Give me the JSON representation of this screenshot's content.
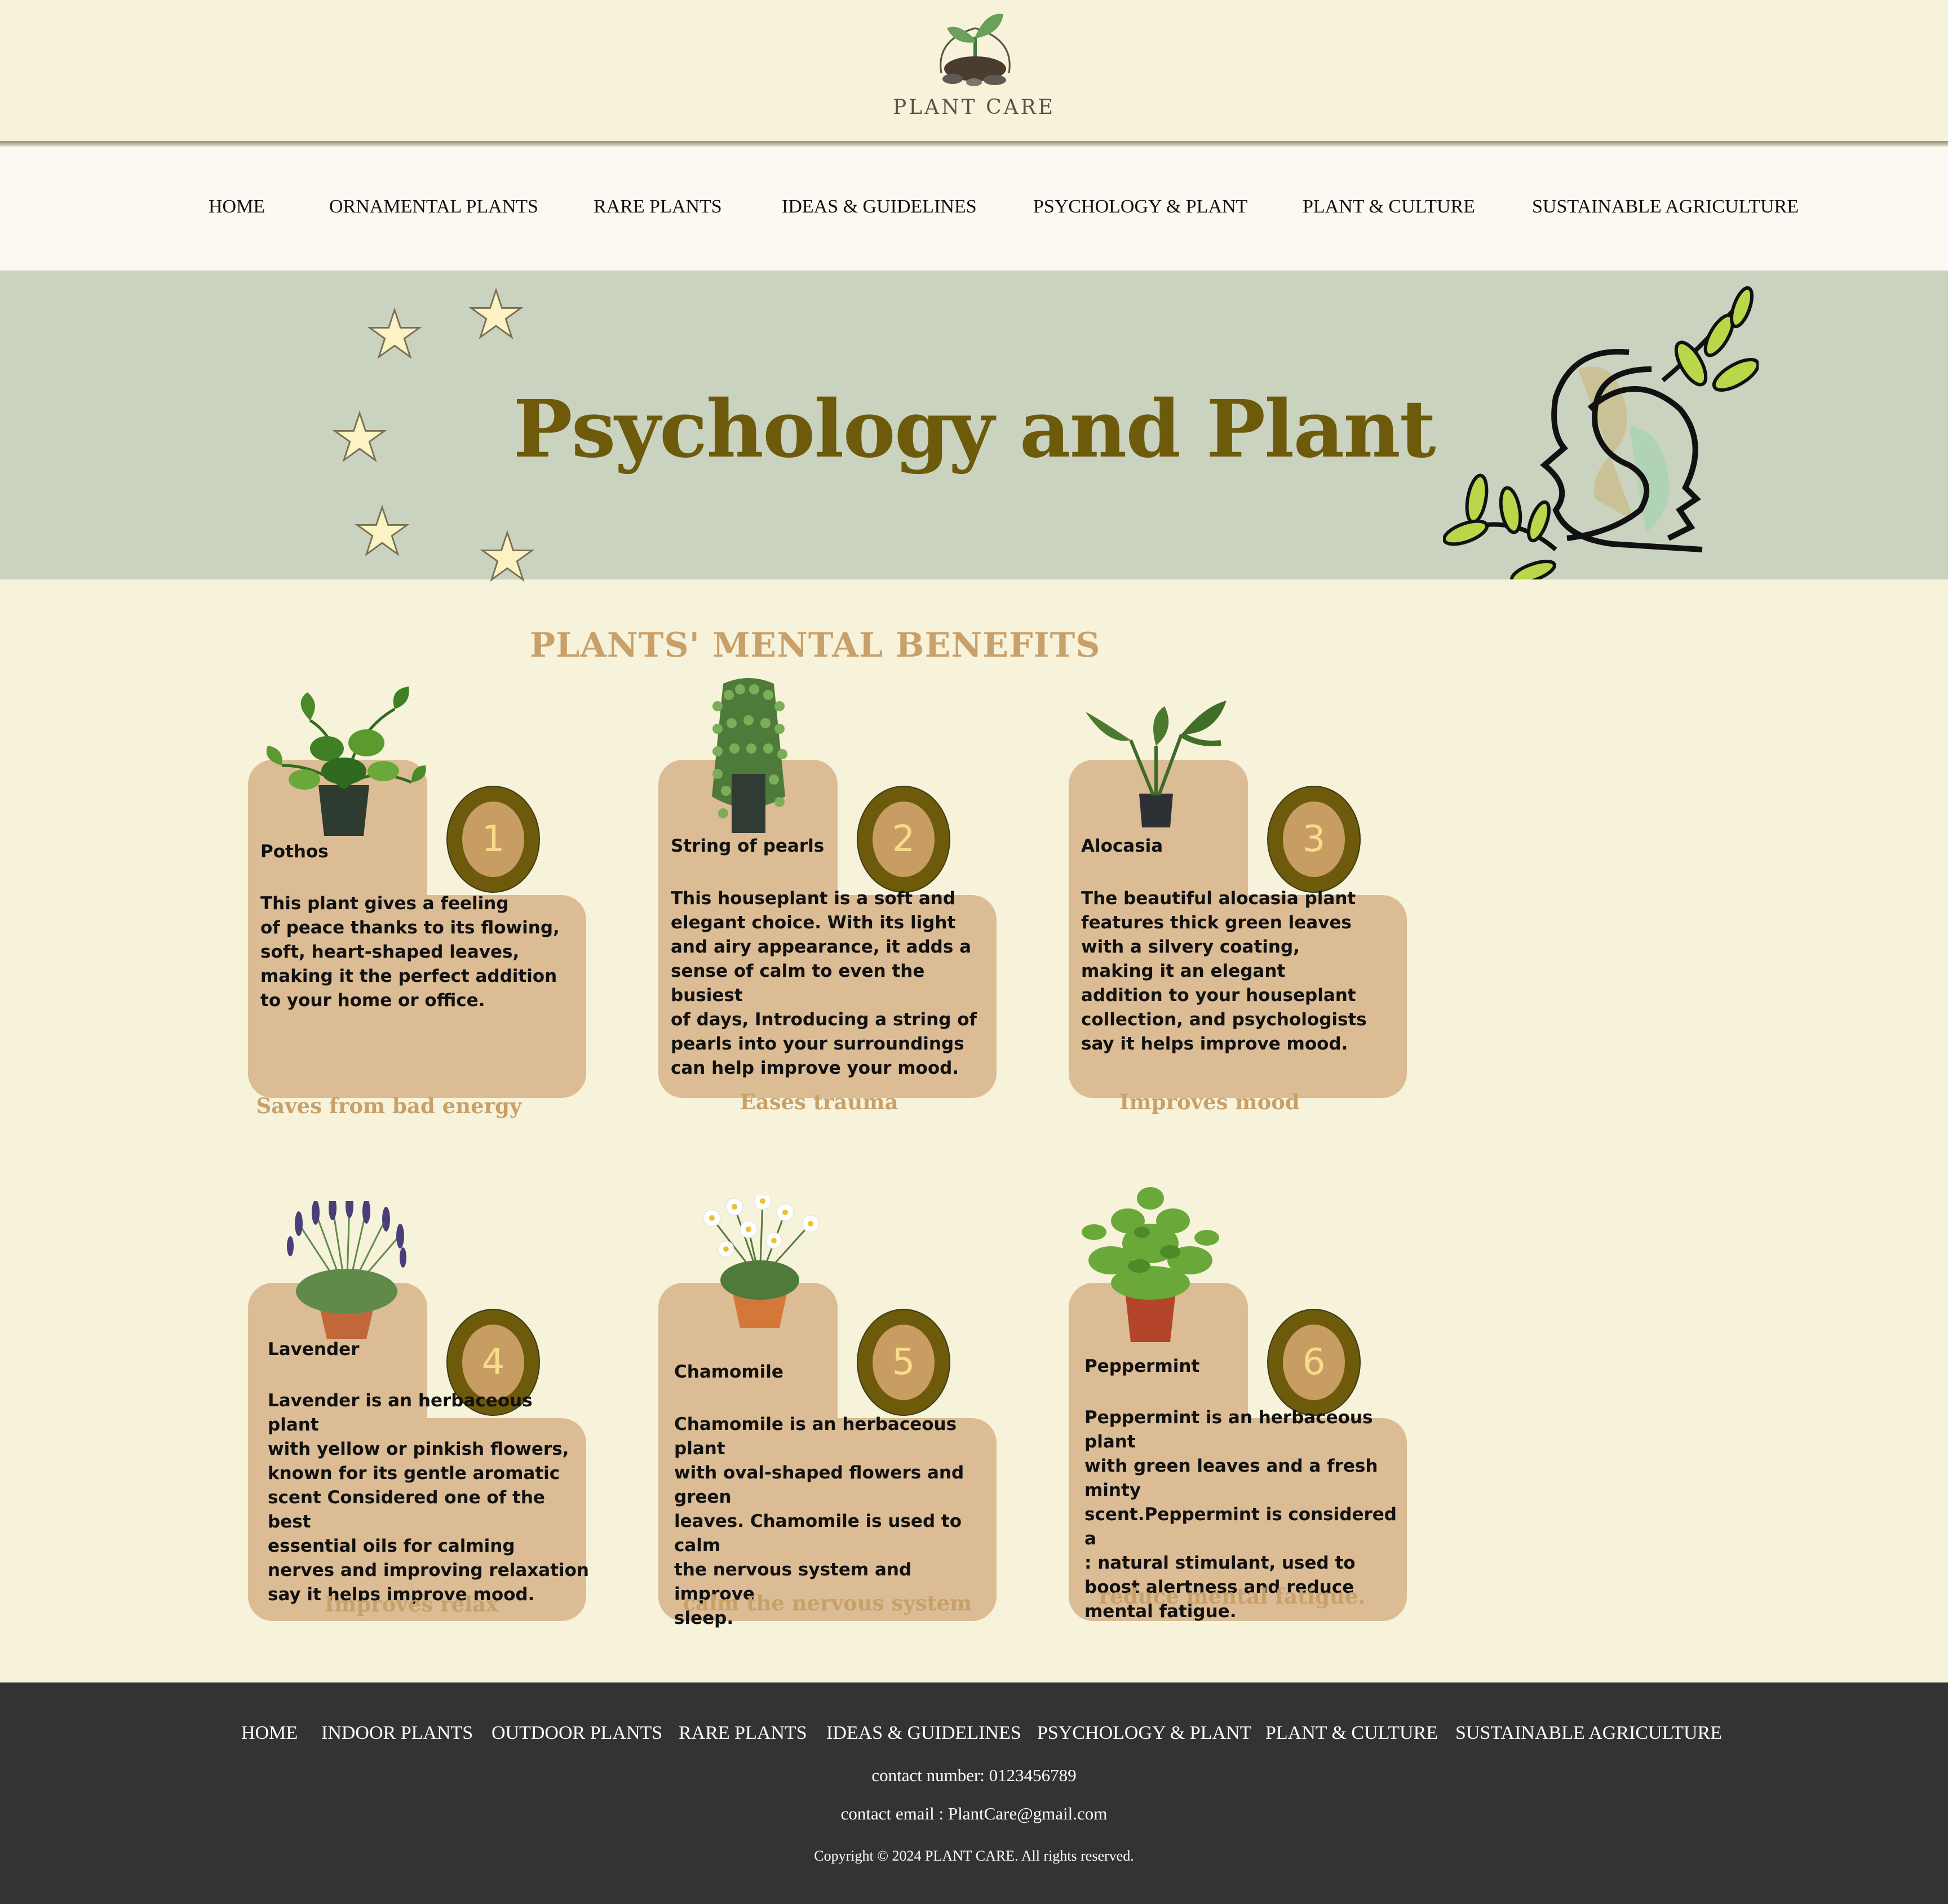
{
  "brand": {
    "name": "PLANT CARE"
  },
  "nav": {
    "items": [
      "HOME",
      "ORNAMENTAL PLANTS",
      "RARE PLANTS",
      "IDEAS & GUIDELINES",
      "PSYCHOLOGY & PLANT",
      "PLANT & CULTURE",
      "SUSTAINABLE AGRICULTURE"
    ]
  },
  "banner": {
    "title": "Psychology and Plant"
  },
  "section": {
    "title": "PLANTS' MENTAL BENEFITS"
  },
  "cards": [
    {
      "number": "1",
      "name": "Pothos",
      "description": "This plant gives a feeling\nof peace thanks to its flowing,\nsoft, heart-shaped leaves,\nmaking it the perfect addition\nto your home or office.",
      "benefit": "Saves from bad energy",
      "plant_icon": "pothos-plant-icon"
    },
    {
      "number": "2",
      "name": "String of pearls",
      "description": "This houseplant is a soft and\nelegant choice. With its light\nand airy appearance, it adds a\nsense of calm to even the busiest\nof days, Introducing a string of\npearls into your surroundings\ncan help improve your mood.",
      "benefit": "Eases trauma",
      "plant_icon": "string-of-pearls-plant-icon"
    },
    {
      "number": "3",
      "name": "Alocasia",
      "description": "The beautiful alocasia plant\nfeatures thick green leaves\nwith a silvery coating,\nmaking it an elegant\naddition to your houseplant\ncollection, and psychologists\nsay it helps improve mood.",
      "benefit": "Improves mood",
      "plant_icon": "alocasia-plant-icon"
    },
    {
      "number": "4",
      "name": "Lavender",
      "description": "Lavender is an herbaceous plant\nwith yellow or pinkish flowers,\nknown for its gentle aromatic\nscent Considered one of the best\nessential oils for calming\nnerves and improving relaxation\nsay it helps improve mood.",
      "benefit": "Improves relax",
      "plant_icon": "lavender-plant-icon"
    },
    {
      "number": "5",
      "name": "Chamomile",
      "description": "Chamomile is an herbaceous plant\nwith oval-shaped flowers and green\nleaves. Chamomile is used to calm\nthe nervous system and improve\nsleep.",
      "benefit": "calm the nervous system",
      "plant_icon": "chamomile-plant-icon"
    },
    {
      "number": "6",
      "name": "Peppermint",
      "description": "Peppermint is an herbaceous plant\nwith green leaves and a fresh minty\nscent.Peppermint is considered a\n: natural stimulant, used to\nboost alertness and reduce\nmental fatigue.",
      "benefit": "reduce mental fatigue.",
      "plant_icon": "peppermint-plant-icon"
    }
  ],
  "footer": {
    "nav": [
      "HOME",
      "INDOOR PLANTS",
      "OUTDOOR PLANTS",
      "RARE PLANTS",
      "IDEAS & GUIDELINES",
      "PSYCHOLOGY & PLANT",
      "PLANT & CULTURE",
      "SUSTAINABLE AGRICULTURE"
    ],
    "contact_number": "contact number: 0123456789",
    "contact_email": "contact email : PlantCare@gmail.com",
    "copyright": "Copyright © 2024 PLANT CARE. All rights reserved."
  },
  "colors": {
    "page_bg": "#f7f2da",
    "nav_bg": "#fdf8f1",
    "banner_bg": "#cad3c0",
    "title_olive": "#6d5a0b",
    "card_tan": "#dbbc94",
    "accent_tan": "#c8a06a",
    "footer_bg": "#333333"
  }
}
